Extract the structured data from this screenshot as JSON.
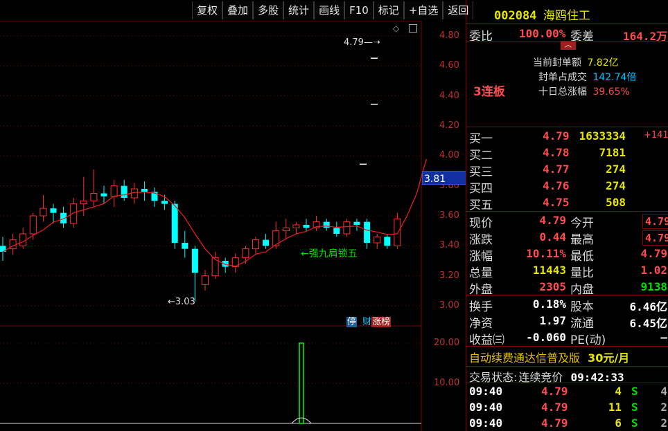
{
  "toolbar": [
    "复权",
    "叠加",
    "多股",
    "统计",
    "画线",
    "F10",
    "标记",
    "+自选",
    "返回"
  ],
  "chart": {
    "price_axis": [
      "4.80",
      "4.60",
      "4.40",
      "4.20",
      "4.00",
      "3.80",
      "3.60",
      "3.40",
      "3.20",
      "3.00"
    ],
    "current_price_tag": "3.81",
    "high_annotation": "4.79",
    "low_annotation": "3.03",
    "signal_label": "←强九肩锁五",
    "badges": {
      "ting": "停",
      "cai": "财",
      "zhangbang": "涨榜"
    },
    "volume_axis": [
      "20.00",
      "10.00"
    ]
  },
  "chart_data": {
    "type": "candlestick",
    "y_axis_range": [
      3.0,
      4.8
    ],
    "volume_range": [
      0,
      20
    ],
    "candles": [
      {
        "o": 3.4,
        "h": 3.46,
        "l": 3.3,
        "c": 3.36,
        "up": false
      },
      {
        "o": 3.38,
        "h": 3.48,
        "l": 3.34,
        "c": 3.44,
        "up": true
      },
      {
        "o": 3.4,
        "h": 3.52,
        "l": 3.38,
        "c": 3.48,
        "up": true
      },
      {
        "o": 3.48,
        "h": 3.62,
        "l": 3.44,
        "c": 3.6,
        "up": true
      },
      {
        "o": 3.6,
        "h": 3.74,
        "l": 3.56,
        "c": 3.65,
        "up": true
      },
      {
        "o": 3.65,
        "h": 3.68,
        "l": 3.55,
        "c": 3.62,
        "up": false
      },
      {
        "o": 3.62,
        "h": 3.66,
        "l": 3.52,
        "c": 3.55,
        "up": false
      },
      {
        "o": 3.55,
        "h": 3.72,
        "l": 3.52,
        "c": 3.68,
        "up": true
      },
      {
        "o": 3.68,
        "h": 3.86,
        "l": 3.6,
        "c": 3.7,
        "up": true
      },
      {
        "o": 3.7,
        "h": 3.91,
        "l": 3.66,
        "c": 3.75,
        "up": true
      },
      {
        "o": 3.75,
        "h": 3.8,
        "l": 3.68,
        "c": 3.73,
        "up": false
      },
      {
        "o": 3.73,
        "h": 3.84,
        "l": 3.66,
        "c": 3.8,
        "up": true
      },
      {
        "o": 3.8,
        "h": 3.84,
        "l": 3.7,
        "c": 3.72,
        "up": false
      },
      {
        "o": 3.72,
        "h": 3.82,
        "l": 3.68,
        "c": 3.78,
        "up": true
      },
      {
        "o": 3.78,
        "h": 3.83,
        "l": 3.7,
        "c": 3.76,
        "up": false
      },
      {
        "o": 3.76,
        "h": 3.79,
        "l": 3.66,
        "c": 3.7,
        "up": false
      },
      {
        "o": 3.7,
        "h": 3.74,
        "l": 3.64,
        "c": 3.68,
        "up": false
      },
      {
        "o": 3.68,
        "h": 3.7,
        "l": 3.38,
        "c": 3.42,
        "up": false
      },
      {
        "o": 3.42,
        "h": 3.5,
        "l": 3.32,
        "c": 3.38,
        "up": false
      },
      {
        "o": 3.38,
        "h": 3.4,
        "l": 3.03,
        "c": 3.22,
        "up": false
      },
      {
        "o": 3.14,
        "h": 3.24,
        "l": 3.1,
        "c": 3.2,
        "up": true
      },
      {
        "o": 3.2,
        "h": 3.36,
        "l": 3.18,
        "c": 3.32,
        "up": true
      },
      {
        "o": 3.3,
        "h": 3.32,
        "l": 3.22,
        "c": 3.26,
        "up": false
      },
      {
        "o": 3.26,
        "h": 3.35,
        "l": 3.22,
        "c": 3.32,
        "up": true
      },
      {
        "o": 3.32,
        "h": 3.4,
        "l": 3.28,
        "c": 3.38,
        "up": true
      },
      {
        "o": 3.38,
        "h": 3.46,
        "l": 3.34,
        "c": 3.44,
        "up": true
      },
      {
        "o": 3.44,
        "h": 3.48,
        "l": 3.38,
        "c": 3.4,
        "up": false
      },
      {
        "o": 3.4,
        "h": 3.56,
        "l": 3.38,
        "c": 3.5,
        "up": true
      },
      {
        "o": 3.5,
        "h": 3.58,
        "l": 3.44,
        "c": 3.52,
        "up": true
      },
      {
        "o": 3.52,
        "h": 3.56,
        "l": 3.48,
        "c": 3.54,
        "up": true
      },
      {
        "o": 3.54,
        "h": 3.58,
        "l": 3.5,
        "c": 3.52,
        "up": false
      },
      {
        "o": 3.52,
        "h": 3.6,
        "l": 3.5,
        "c": 3.56,
        "up": true
      },
      {
        "o": 3.56,
        "h": 3.58,
        "l": 3.5,
        "c": 3.52,
        "up": false
      },
      {
        "o": 3.52,
        "h": 3.56,
        "l": 3.46,
        "c": 3.48,
        "up": false
      },
      {
        "o": 3.48,
        "h": 3.58,
        "l": 3.46,
        "c": 3.56,
        "up": true
      },
      {
        "o": 3.56,
        "h": 3.58,
        "l": 3.5,
        "c": 3.54,
        "up": false
      },
      {
        "o": 3.56,
        "h": 3.58,
        "l": 3.38,
        "c": 3.42,
        "up": false
      },
      {
        "o": 3.42,
        "h": 3.48,
        "l": 3.38,
        "c": 3.46,
        "up": true
      },
      {
        "o": 3.46,
        "h": 3.48,
        "l": 3.38,
        "c": 3.4,
        "up": false
      },
      {
        "o": 3.4,
        "h": 3.62,
        "l": 3.38,
        "c": 3.58,
        "up": true
      }
    ],
    "ma_after_last": [
      3.6,
      3.75,
      3.98
    ],
    "limit_dashes": [
      4.79,
      4.4,
      4.0
    ],
    "volume_spike": {
      "index": 36,
      "value": 20
    }
  },
  "panel": {
    "stock_code": "002084",
    "stock_name": "海鸥住工",
    "weibi_label": "委比",
    "weibi_value": "100.00%",
    "weicha_label": "委差",
    "weicha_value": "164.2万",
    "seal_amount_label": "当前封单额",
    "seal_amount_value": "7.82亿",
    "seal_ratio_label": "封单占成交",
    "seal_ratio_value": "142.74倍",
    "ten_day_label": "十日总涨幅",
    "ten_day_value": "39.65%",
    "streak": "3连板",
    "bids": [
      {
        "label": "买一",
        "price": "4.79",
        "vol": "1633334",
        "chg": "+141"
      },
      {
        "label": "买二",
        "price": "4.78",
        "vol": "7181",
        "chg": ""
      },
      {
        "label": "买三",
        "price": "4.77",
        "vol": "274",
        "chg": ""
      },
      {
        "label": "买四",
        "price": "4.76",
        "vol": "274",
        "chg": ""
      },
      {
        "label": "买五",
        "price": "4.75",
        "vol": "508",
        "chg": ""
      }
    ],
    "quote": [
      {
        "l1": "现价",
        "v1": "4.79",
        "c1": "red",
        "l2": "今开",
        "v2": "4.79",
        "c2": "red",
        "box": true
      },
      {
        "l1": "涨跌",
        "v1": "0.44",
        "c1": "red",
        "l2": "最高",
        "v2": "4.79",
        "c2": "red",
        "box": true
      },
      {
        "l1": "涨幅",
        "v1": "10.11%",
        "c1": "red",
        "l2": "最低",
        "v2": "4.79",
        "c2": "red",
        "box": false
      },
      {
        "l1": "总量",
        "v1": "11443",
        "c1": "yel",
        "l2": "量比",
        "v2": "1.02",
        "c2": "red",
        "box": false
      },
      {
        "l1": "外盘",
        "v1": "2305",
        "c1": "red",
        "l2": "内盘",
        "v2": "9138",
        "c2": "grn",
        "box": false
      }
    ],
    "fund": [
      {
        "l1": "换手",
        "v1": "0.18%",
        "l2": "股本",
        "v2": "6.46亿"
      },
      {
        "l1": "净资",
        "v1": "1.97",
        "l2": "流通",
        "v2": "6.45亿"
      },
      {
        "l1": "收益㈢",
        "v1": "-0.060",
        "l2": "PE(动)",
        "v2": "–"
      }
    ],
    "promo": "自动续费通达信普及版",
    "promo_price": "30元/月",
    "trade_status_label": "交易状态:",
    "trade_status": "连续竞价",
    "trade_time": "09:42:33",
    "ticks": [
      {
        "time": "09:40",
        "price": "4.79",
        "vol": "4",
        "side": "S",
        "n": "4"
      },
      {
        "time": "09:40",
        "price": "4.79",
        "vol": "11",
        "side": "S",
        "n": "2"
      },
      {
        "time": "09:40",
        "price": "4.79",
        "vol": "6",
        "side": "S",
        "n": "2"
      }
    ]
  }
}
